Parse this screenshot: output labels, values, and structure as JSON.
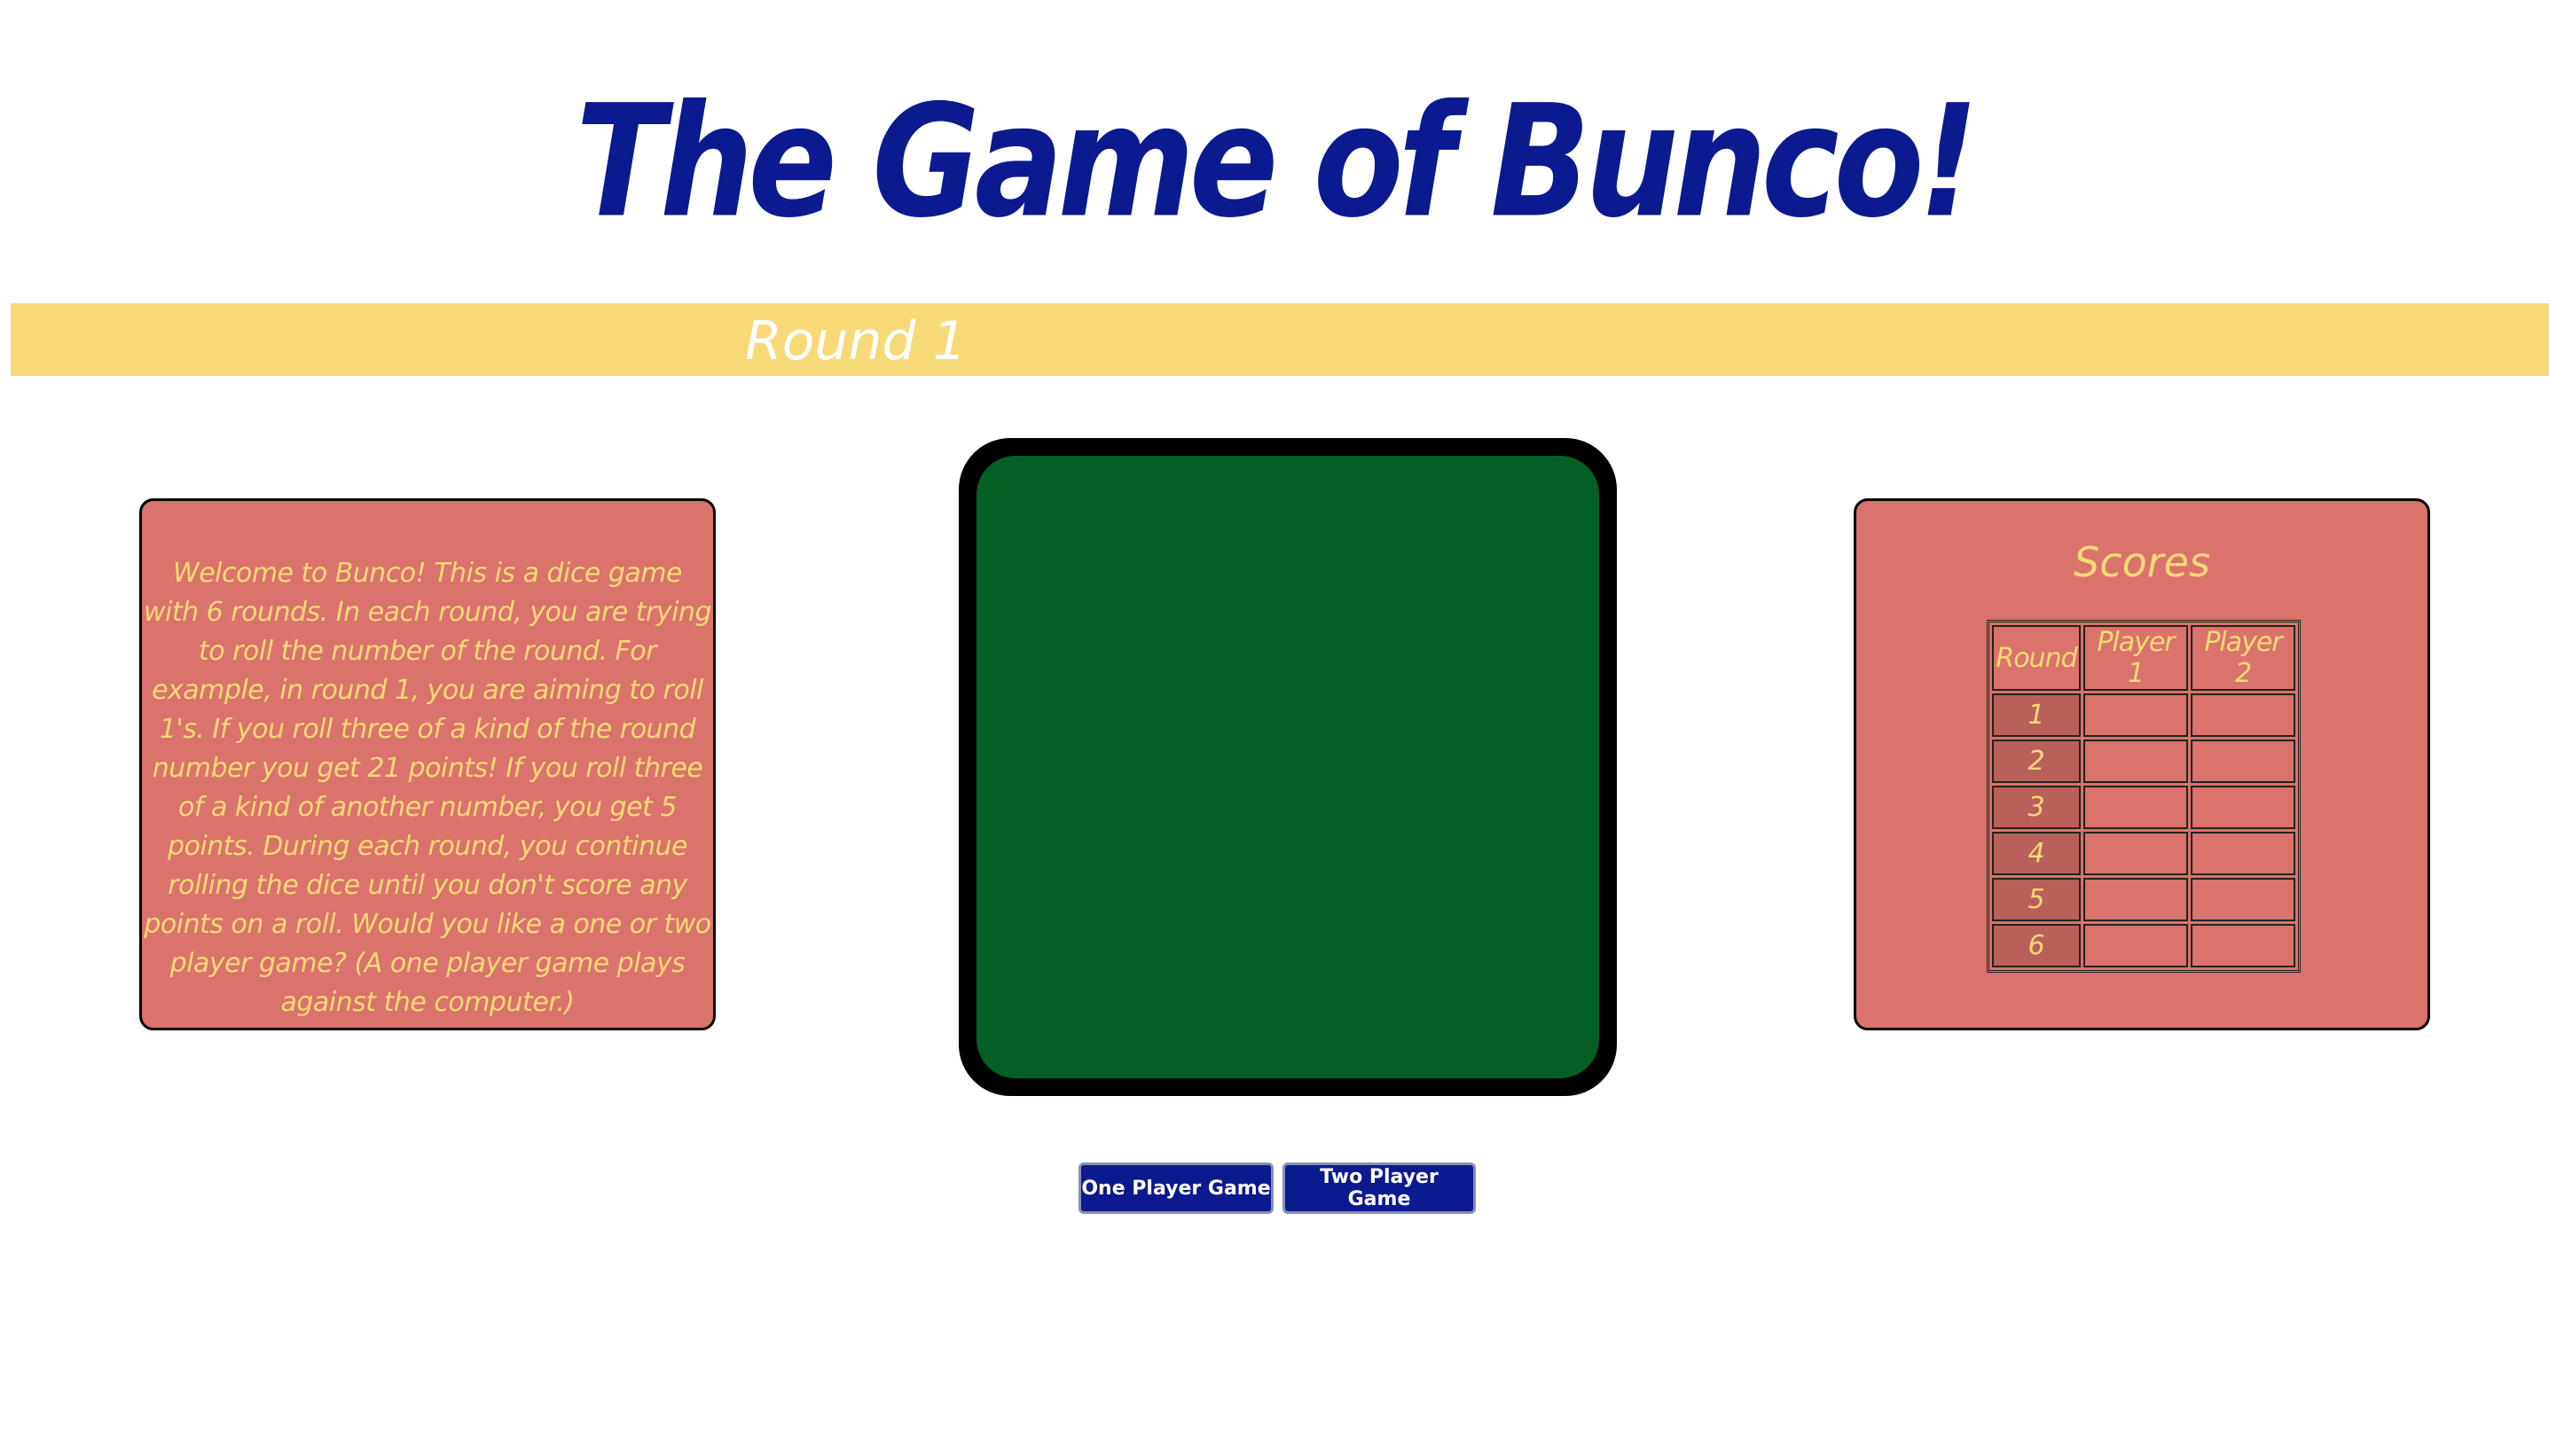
{
  "header": {
    "title": "The Game of Bunco!"
  },
  "round_bar": {
    "label": "Round 1"
  },
  "instructions": {
    "text": "Welcome to Bunco! This is a dice game with 6 rounds. In each round, you are trying to roll the number of the round. For example, in round 1, you are aiming to roll 1's. If you roll three of a kind of the round number you get 21 points! If you roll three of a kind of another number, you get 5 points. During each round, you continue rolling the dice until you don't score any points on a roll. Would you like a one or two player game? (A one player game plays against the computer.)"
  },
  "scores": {
    "title": "Scores",
    "columns": [
      "Round",
      "Player 1",
      "Player 2"
    ],
    "rows": [
      {
        "round": "1",
        "p1": "",
        "p2": ""
      },
      {
        "round": "2",
        "p1": "",
        "p2": ""
      },
      {
        "round": "3",
        "p1": "",
        "p2": ""
      },
      {
        "round": "4",
        "p1": "",
        "p2": ""
      },
      {
        "round": "5",
        "p1": "",
        "p2": ""
      },
      {
        "round": "6",
        "p1": "",
        "p2": ""
      }
    ]
  },
  "buttons": {
    "one_player": "One Player Game",
    "two_player": "Two Player Game"
  },
  "colors": {
    "title": "#0c1a8f",
    "round_bar": "#f7d977",
    "panel": "#d9736b",
    "felt": "#045f27",
    "button": "#0c1a8f"
  }
}
